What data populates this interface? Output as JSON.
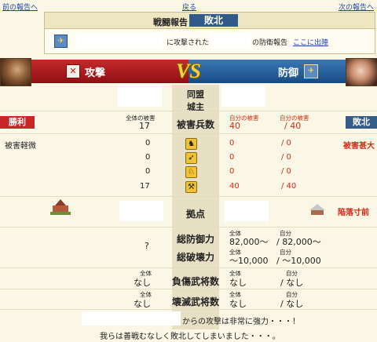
{
  "nav": {
    "prev": "前の報告へ",
    "back": "戻る",
    "next": "次の報告へ"
  },
  "header": {
    "title": "戦闘報告",
    "result": "敗北",
    "message_mid": "に攻撃された",
    "message_end": "の防衛報告",
    "sortie_link": "ここに出陣"
  },
  "banner": {
    "attack": "攻撃",
    "vs": "VS",
    "defense": "防御"
  },
  "labels": {
    "alliance": "同盟",
    "lord": "城主",
    "damage_troops": "被害兵数",
    "base": "拠点",
    "total_def": "総防御力",
    "total_break": "総破壊力",
    "injured": "負傷武将数",
    "destroyed": "壊滅武将数"
  },
  "attacker": {
    "result": "勝利",
    "damage_desc": "被害軽微",
    "total_label": "全体の被害",
    "total": "17",
    "units": [
      "0",
      "0",
      "0",
      "17"
    ],
    "question": "?",
    "injured_label": "全体",
    "injured": "なし",
    "destroyed_label": "全体",
    "destroyed": "なし"
  },
  "defender": {
    "result": "敗北",
    "damage_desc": "被害甚大",
    "base_status": "陥落寸前",
    "own_label": "自分の被害",
    "total": "40",
    "own": "/ 40",
    "units": [
      {
        "total": "0",
        "own": "/ 0"
      },
      {
        "total": "0",
        "own": "/ 0"
      },
      {
        "total": "0",
        "own": "/ 0"
      },
      {
        "total": "40",
        "own": "/ 40"
      }
    ],
    "def_total_label": "全体",
    "def_own_label": "自分",
    "def_total": "82,000〜",
    "def_own": "/ 82,000〜",
    "break_total_label": "全体",
    "break_own_label": "自分",
    "break_total": "〜10,000",
    "break_own": "/ 〜10,000",
    "injured_total_label": "全体",
    "injured_own_label": "自分",
    "injured_total": "なし",
    "injured_own": "/ なし",
    "destroyed_total_label": "全体",
    "destroyed_own_label": "自分",
    "destroyed_total": "なし",
    "destroyed_own": "/ なし"
  },
  "footer": {
    "line1": "からの攻撃は非常に強力・・・！",
    "line2": "我らは善戦むなしく敗北してしまいました・・・。"
  },
  "colors": {
    "attack": "#b8161d",
    "defense": "#1e5a9a",
    "vs": "#e8c63a",
    "loss_badge": "#355c88",
    "win_badge": "#c62828"
  }
}
